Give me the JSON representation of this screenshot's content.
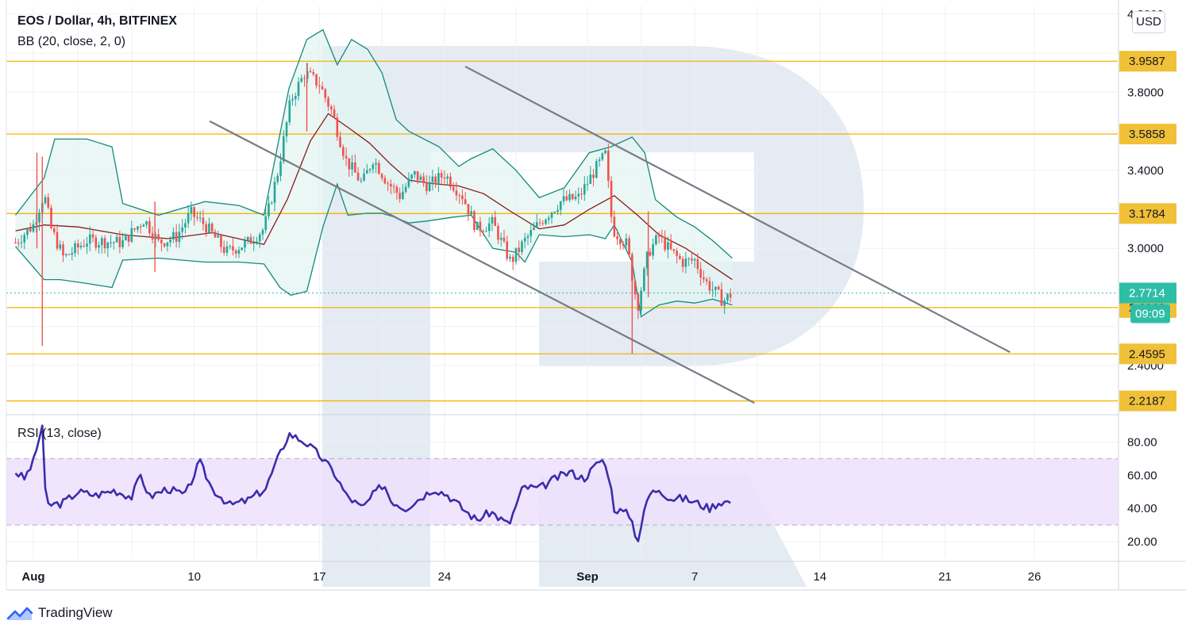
{
  "header": {
    "symbol": "EOS / Dollar, 4h, BITFINEX",
    "bb_label": "BB (20, close, 2, 0)",
    "rsi_label": "RSI (13, close)",
    "currency": "USD",
    "brand": "TradingView",
    "countdown": "09:09"
  },
  "colors": {
    "up": "#26a69a",
    "down": "#ef5350",
    "level": "#f4b400",
    "level_tag": "#f0c038",
    "bb_band": "#138a7c",
    "bb_fill": "#e3f4f2",
    "bb_basis": "#8b1a1a",
    "channel": "#787b86",
    "rsi_line": "#3b2dab",
    "rsi_band": "#ede0fb",
    "price_tag": "#2ebea8",
    "watermark": "#dfe7f1"
  },
  "chart_data": [
    {
      "type": "candlestick",
      "title": "EOS / Dollar, 4h, BITFINEX",
      "ylim": [
        2.16,
        4.24
      ],
      "y_ticks": [
        "2.4000",
        "3.0000",
        "3.4000",
        "3.8000",
        "4.2000"
      ],
      "x_ticks": [
        {
          "label": "Aug",
          "day": 1
        },
        {
          "label": "10",
          "day": 10
        },
        {
          "label": "17",
          "day": 17
        },
        {
          "label": "24",
          "day": 24
        },
        {
          "label": "Sep",
          "day": 32
        },
        {
          "label": "7",
          "day": 38
        },
        {
          "label": "14",
          "day": 45
        },
        {
          "label": "21",
          "day": 52
        },
        {
          "label": "26",
          "day": 57
        }
      ],
      "horizontal_levels": [
        {
          "label": "3.9587",
          "value": 3.9587
        },
        {
          "label": "3.5858",
          "value": 3.5858
        },
        {
          "label": "3.1784",
          "value": 3.1784
        },
        {
          "label": "2.6969",
          "value": 2.6969
        },
        {
          "label": "2.4595",
          "value": 2.4595
        },
        {
          "label": "2.2187",
          "value": 2.2187
        }
      ],
      "last_price": {
        "label": "2.7714",
        "value": 2.7714
      },
      "channel_lines": [
        {
          "from": {
            "day": 10.9,
            "value": 3.65
          },
          "to": {
            "day": 41.3,
            "value": 2.21
          }
        },
        {
          "from": {
            "day": 25.2,
            "value": 3.93
          },
          "to": {
            "day": 55.6,
            "value": 2.47
          }
        }
      ],
      "close_anchors": [
        {
          "day": 0.0,
          "value": 3.03
        },
        {
          "day": 1.0,
          "value": 3.12
        },
        {
          "day": 1.6,
          "value": 3.28
        },
        {
          "day": 2.0,
          "value": 3.1
        },
        {
          "day": 2.7,
          "value": 2.95
        },
        {
          "day": 4.0,
          "value": 3.04
        },
        {
          "day": 6.0,
          "value": 3.03
        },
        {
          "day": 7.2,
          "value": 3.15
        },
        {
          "day": 8.0,
          "value": 3.03
        },
        {
          "day": 9.0,
          "value": 3.06
        },
        {
          "day": 9.8,
          "value": 3.18
        },
        {
          "day": 10.6,
          "value": 3.12
        },
        {
          "day": 11.8,
          "value": 2.98
        },
        {
          "day": 13.0,
          "value": 3.03
        },
        {
          "day": 13.9,
          "value": 3.1
        },
        {
          "day": 14.7,
          "value": 3.4
        },
        {
          "day": 15.4,
          "value": 3.76
        },
        {
          "day": 16.2,
          "value": 3.9
        },
        {
          "day": 17.0,
          "value": 3.84
        },
        {
          "day": 17.7,
          "value": 3.7
        },
        {
          "day": 18.5,
          "value": 3.45
        },
        {
          "day": 19.4,
          "value": 3.33
        },
        {
          "day": 20.0,
          "value": 3.46
        },
        {
          "day": 20.8,
          "value": 3.34
        },
        {
          "day": 21.5,
          "value": 3.27
        },
        {
          "day": 22.3,
          "value": 3.38
        },
        {
          "day": 23.1,
          "value": 3.32
        },
        {
          "day": 24.0,
          "value": 3.38
        },
        {
          "day": 25.0,
          "value": 3.27
        },
        {
          "day": 25.8,
          "value": 3.1
        },
        {
          "day": 26.7,
          "value": 3.13
        },
        {
          "day": 27.7,
          "value": 2.93
        },
        {
          "day": 28.5,
          "value": 3.04
        },
        {
          "day": 29.5,
          "value": 3.15
        },
        {
          "day": 30.5,
          "value": 3.24
        },
        {
          "day": 31.5,
          "value": 3.26
        },
        {
          "day": 32.4,
          "value": 3.4
        },
        {
          "day": 33.0,
          "value": 3.48
        },
        {
          "day": 33.4,
          "value": 3.1
        },
        {
          "day": 34.2,
          "value": 3.02
        },
        {
          "day": 34.8,
          "value": 2.7
        },
        {
          "day": 35.4,
          "value": 2.98
        },
        {
          "day": 36.0,
          "value": 3.06
        },
        {
          "day": 36.6,
          "value": 2.99
        },
        {
          "day": 37.3,
          "value": 2.93
        },
        {
          "day": 38.0,
          "value": 2.94
        },
        {
          "day": 38.6,
          "value": 2.83
        },
        {
          "day": 39.1,
          "value": 2.78
        },
        {
          "day": 39.6,
          "value": 2.73
        },
        {
          "day": 40.1,
          "value": 2.7714
        }
      ],
      "wick_spikes": [
        {
          "day": 1.2,
          "high": 3.49,
          "low": 3.0
        },
        {
          "day": 1.5,
          "high": 3.47,
          "low": 2.5
        },
        {
          "day": 7.8,
          "high": 3.24,
          "low": 2.88
        },
        {
          "day": 16.3,
          "high": 3.95,
          "low": 3.6
        },
        {
          "day": 34.5,
          "high": 2.98,
          "low": 2.46
        },
        {
          "day": 35.4,
          "high": 3.19,
          "low": 2.75
        }
      ],
      "bollinger_bands": {
        "upper": [
          {
            "day": 0.0,
            "value": 3.17
          },
          {
            "day": 1.6,
            "value": 3.36
          },
          {
            "day": 2.2,
            "value": 3.56
          },
          {
            "day": 4.0,
            "value": 3.56
          },
          {
            "day": 5.4,
            "value": 3.52
          },
          {
            "day": 6.0,
            "value": 3.23
          },
          {
            "day": 8.0,
            "value": 3.17
          },
          {
            "day": 10.6,
            "value": 3.24
          },
          {
            "day": 12.5,
            "value": 3.22
          },
          {
            "day": 13.9,
            "value": 3.17
          },
          {
            "day": 15.3,
            "value": 3.82
          },
          {
            "day": 16.3,
            "value": 4.07
          },
          {
            "day": 17.2,
            "value": 4.12
          },
          {
            "day": 18.0,
            "value": 3.94
          },
          {
            "day": 18.8,
            "value": 4.07
          },
          {
            "day": 19.7,
            "value": 4.02
          },
          {
            "day": 20.5,
            "value": 3.9
          },
          {
            "day": 21.3,
            "value": 3.66
          },
          {
            "day": 22.0,
            "value": 3.6
          },
          {
            "day": 23.7,
            "value": 3.52
          },
          {
            "day": 24.8,
            "value": 3.42
          },
          {
            "day": 25.5,
            "value": 3.46
          },
          {
            "day": 26.7,
            "value": 3.51
          },
          {
            "day": 28.0,
            "value": 3.4
          },
          {
            "day": 29.3,
            "value": 3.26
          },
          {
            "day": 30.7,
            "value": 3.31
          },
          {
            "day": 32.1,
            "value": 3.49
          },
          {
            "day": 33.3,
            "value": 3.52
          },
          {
            "day": 34.5,
            "value": 3.57
          },
          {
            "day": 35.2,
            "value": 3.49
          },
          {
            "day": 35.8,
            "value": 3.25
          },
          {
            "day": 37.0,
            "value": 3.16
          },
          {
            "day": 38.0,
            "value": 3.11
          },
          {
            "day": 39.0,
            "value": 3.04
          },
          {
            "day": 40.1,
            "value": 2.95
          }
        ],
        "basis": [
          {
            "day": 0.0,
            "value": 3.09
          },
          {
            "day": 1.6,
            "value": 3.12
          },
          {
            "day": 3.5,
            "value": 3.11
          },
          {
            "day": 6.0,
            "value": 3.07
          },
          {
            "day": 8.5,
            "value": 3.05
          },
          {
            "day": 11.0,
            "value": 3.08
          },
          {
            "day": 13.9,
            "value": 3.02
          },
          {
            "day": 15.2,
            "value": 3.25
          },
          {
            "day": 16.5,
            "value": 3.55
          },
          {
            "day": 17.5,
            "value": 3.69
          },
          {
            "day": 18.6,
            "value": 3.62
          },
          {
            "day": 19.8,
            "value": 3.54
          },
          {
            "day": 21.0,
            "value": 3.43
          },
          {
            "day": 22.0,
            "value": 3.35
          },
          {
            "day": 23.5,
            "value": 3.33
          },
          {
            "day": 24.8,
            "value": 3.32
          },
          {
            "day": 26.2,
            "value": 3.28
          },
          {
            "day": 27.7,
            "value": 3.19
          },
          {
            "day": 29.3,
            "value": 3.1
          },
          {
            "day": 30.7,
            "value": 3.12
          },
          {
            "day": 32.1,
            "value": 3.2
          },
          {
            "day": 33.5,
            "value": 3.27
          },
          {
            "day": 34.8,
            "value": 3.17
          },
          {
            "day": 36.0,
            "value": 3.07
          },
          {
            "day": 37.5,
            "value": 3.0
          },
          {
            "day": 38.8,
            "value": 2.92
          },
          {
            "day": 40.1,
            "value": 2.84
          }
        ],
        "lower": [
          {
            "day": 0.0,
            "value": 3.01
          },
          {
            "day": 1.6,
            "value": 2.84
          },
          {
            "day": 2.5,
            "value": 2.84
          },
          {
            "day": 4.0,
            "value": 2.82
          },
          {
            "day": 5.4,
            "value": 2.8
          },
          {
            "day": 6.0,
            "value": 2.94
          },
          {
            "day": 8.0,
            "value": 2.95
          },
          {
            "day": 10.6,
            "value": 2.93
          },
          {
            "day": 12.5,
            "value": 2.93
          },
          {
            "day": 13.9,
            "value": 2.92
          },
          {
            "day": 14.8,
            "value": 2.8
          },
          {
            "day": 15.4,
            "value": 2.76
          },
          {
            "day": 16.3,
            "value": 2.78
          },
          {
            "day": 17.2,
            "value": 3.11
          },
          {
            "day": 18.0,
            "value": 3.33
          },
          {
            "day": 18.6,
            "value": 3.17
          },
          {
            "day": 19.7,
            "value": 3.18
          },
          {
            "day": 20.5,
            "value": 3.18
          },
          {
            "day": 21.2,
            "value": 3.16
          },
          {
            "day": 22.0,
            "value": 3.13
          },
          {
            "day": 23.0,
            "value": 3.14
          },
          {
            "day": 24.5,
            "value": 3.16
          },
          {
            "day": 25.5,
            "value": 3.17
          },
          {
            "day": 26.7,
            "value": 3.0
          },
          {
            "day": 28.0,
            "value": 2.98
          },
          {
            "day": 28.5,
            "value": 2.93
          },
          {
            "day": 29.3,
            "value": 3.07
          },
          {
            "day": 30.7,
            "value": 3.06
          },
          {
            "day": 32.1,
            "value": 3.07
          },
          {
            "day": 33.0,
            "value": 3.05
          },
          {
            "day": 33.5,
            "value": 3.12
          },
          {
            "day": 34.5,
            "value": 2.93
          },
          {
            "day": 35.0,
            "value": 2.65
          },
          {
            "day": 36.0,
            "value": 2.71
          },
          {
            "day": 37.0,
            "value": 2.73
          },
          {
            "day": 38.0,
            "value": 2.72
          },
          {
            "day": 39.0,
            "value": 2.74
          },
          {
            "day": 40.1,
            "value": 2.71
          }
        ]
      }
    },
    {
      "type": "line",
      "title": "RSI (13, close)",
      "ylim": [
        10,
        95
      ],
      "y_ticks": [
        "20.00",
        "40.00",
        "60.00",
        "80.00"
      ],
      "band": {
        "upper": 70,
        "lower": 30
      },
      "series": [
        {
          "values": [
            {
              "day": 0.0,
              "value": 62
            },
            {
              "day": 0.5,
              "value": 58
            },
            {
              "day": 1.0,
              "value": 68
            },
            {
              "day": 1.5,
              "value": 90
            },
            {
              "day": 1.7,
              "value": 42
            },
            {
              "day": 2.6,
              "value": 43
            },
            {
              "day": 3.5,
              "value": 50
            },
            {
              "day": 4.5,
              "value": 48
            },
            {
              "day": 5.5,
              "value": 51
            },
            {
              "day": 6.5,
              "value": 47
            },
            {
              "day": 7.0,
              "value": 60
            },
            {
              "day": 7.5,
              "value": 47
            },
            {
              "day": 8.5,
              "value": 52
            },
            {
              "day": 9.5,
              "value": 48
            },
            {
              "day": 10.3,
              "value": 68
            },
            {
              "day": 11.0,
              "value": 52
            },
            {
              "day": 12.0,
              "value": 42
            },
            {
              "day": 13.0,
              "value": 45
            },
            {
              "day": 14.0,
              "value": 52
            },
            {
              "day": 14.6,
              "value": 68
            },
            {
              "day": 15.3,
              "value": 85
            },
            {
              "day": 16.2,
              "value": 80
            },
            {
              "day": 17.0,
              "value": 72
            },
            {
              "day": 17.8,
              "value": 62
            },
            {
              "day": 18.5,
              "value": 48
            },
            {
              "day": 19.4,
              "value": 40
            },
            {
              "day": 20.0,
              "value": 48
            },
            {
              "day": 20.6,
              "value": 55
            },
            {
              "day": 21.0,
              "value": 45
            },
            {
              "day": 21.8,
              "value": 40
            },
            {
              "day": 22.6,
              "value": 46
            },
            {
              "day": 23.4,
              "value": 52
            },
            {
              "day": 24.2,
              "value": 48
            },
            {
              "day": 25.0,
              "value": 40
            },
            {
              "day": 25.8,
              "value": 33
            },
            {
              "day": 26.6,
              "value": 38
            },
            {
              "day": 27.6,
              "value": 30
            },
            {
              "day": 28.4,
              "value": 53
            },
            {
              "day": 29.3,
              "value": 52
            },
            {
              "day": 30.2,
              "value": 58
            },
            {
              "day": 31.0,
              "value": 62
            },
            {
              "day": 31.8,
              "value": 58
            },
            {
              "day": 32.8,
              "value": 70
            },
            {
              "day": 33.2,
              "value": 60
            },
            {
              "day": 33.5,
              "value": 40
            },
            {
              "day": 34.4,
              "value": 36
            },
            {
              "day": 34.8,
              "value": 20
            },
            {
              "day": 35.4,
              "value": 48
            },
            {
              "day": 36.0,
              "value": 52
            },
            {
              "day": 36.6,
              "value": 46
            },
            {
              "day": 37.4,
              "value": 46
            },
            {
              "day": 38.2,
              "value": 43
            },
            {
              "day": 38.8,
              "value": 40
            },
            {
              "day": 39.4,
              "value": 44
            },
            {
              "day": 40.1,
              "value": 44
            }
          ]
        }
      ]
    }
  ]
}
